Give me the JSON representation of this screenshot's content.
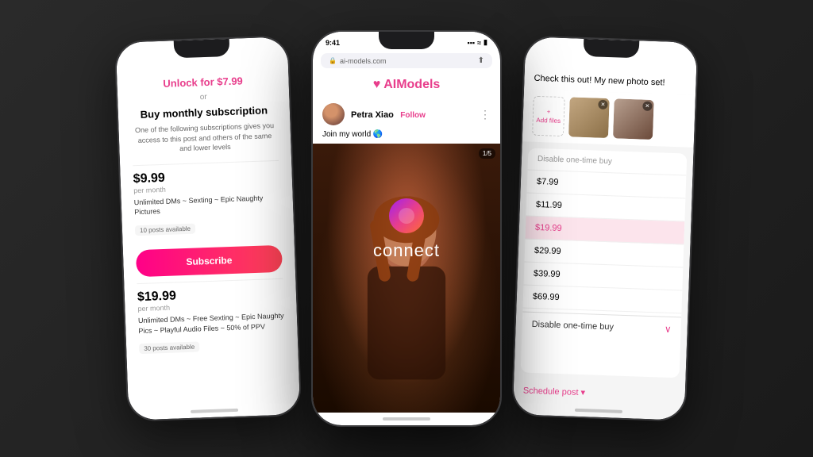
{
  "scene": {
    "background": "#1a1a1a"
  },
  "logo": {
    "text": "connect",
    "icon_colors": [
      "#f08",
      "#f45",
      "#a020f0"
    ]
  },
  "phone1": {
    "unlock_label": "Unlock for $7.99",
    "or_text": "or",
    "buy_monthly_label": "Buy monthly subscription",
    "sub_desc": "One of the following subscriptions gives you access to this post and others of the same and lower levels",
    "plan1": {
      "price": "$9.99",
      "per_month": "per month",
      "description": "Unlimited DMs ~ Sexting ~ Epic Naughty Pictures",
      "posts_available": "10 posts available",
      "subscribe_label": "Subscribe"
    },
    "plan2": {
      "price": "$19.99",
      "per_month": "per month",
      "description": "Unlimited DMs ~ Free Sexting ~ Epic Naughty Pics ~ Playful Audio Files ~ 50% of PPV",
      "posts_available": "30 posts available"
    }
  },
  "phone2": {
    "time": "9:41",
    "url": "ai-models.com",
    "site_name": "AIModels",
    "profile_name": "Petra Xiao",
    "follow_label": "Follow",
    "bio": "Join my world 🌎",
    "post_counter": "1/5"
  },
  "phone3": {
    "header_text": "Check this out! My new photo set!",
    "add_files_label": "Add files",
    "dropdown_label1": "Disable one-time buy",
    "prices": [
      "$7.99",
      "$11.99",
      "$19.99",
      "$29.99",
      "$39.99",
      "$69.99"
    ],
    "selected_price": "$19.99",
    "dropdown_label2": "Disable one-time buy",
    "schedule_label": "Schedule post ▾"
  }
}
